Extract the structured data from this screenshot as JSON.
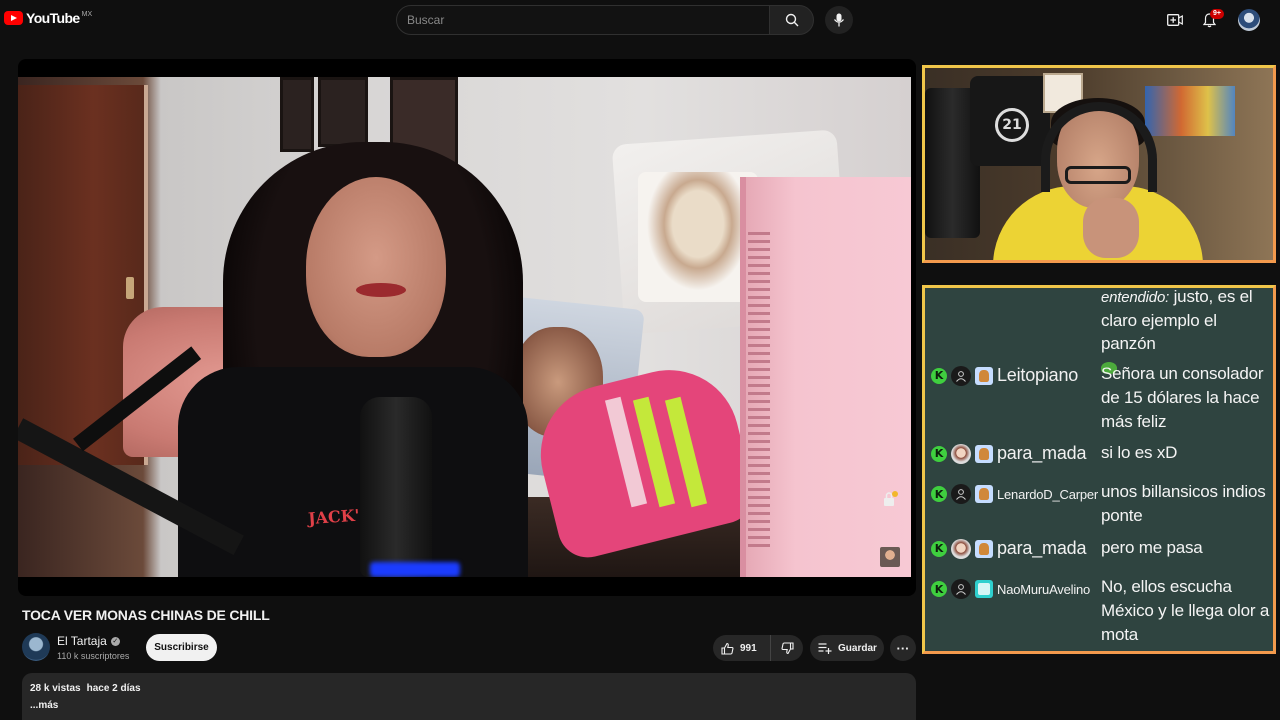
{
  "topbar": {
    "logo_text": "YouTube",
    "country_code": "MX",
    "search_placeholder": "Buscar",
    "notification_count": "9+",
    "icons": [
      "youtube-logo",
      "search-icon",
      "mic-icon",
      "create-icon",
      "bell-icon",
      "account-avatar"
    ]
  },
  "video": {
    "title": "TOCA VER MONAS CHINAS DE CHILL",
    "shirt_print": "JACK'S"
  },
  "webcam": {
    "poster_number": "21"
  },
  "chat": {
    "top_message": {
      "user_partial": "entendido:",
      "text": "justo, es el claro ejemplo el panzón"
    },
    "messages": [
      {
        "user": "Leitopiano",
        "text": "Señora un consolador de 15 dólares la hace más feliz"
      },
      {
        "user": "para_mada",
        "text": "si lo es xD"
      },
      {
        "user": "LenardoD_Carper",
        "text": "unos billansicos indios ponte"
      },
      {
        "user": "para_mada",
        "text": "pero me pasa"
      },
      {
        "user": "NaoMuruAvelino",
        "text": "No, ellos escucha México y le llega olor a mota"
      }
    ],
    "badge_letter": "K"
  },
  "channel": {
    "name": "El Tartaja",
    "subscribers": "110 k suscriptores",
    "subscribe_label": "Suscribirse"
  },
  "actions": {
    "like_count": "991",
    "save_label": "Guardar",
    "more_label": "···"
  },
  "description": {
    "views": "28 k vistas",
    "date": "hace 2 días",
    "more": "...más"
  },
  "colors": {
    "background": "#0f0f0f",
    "youtube_red": "#ff0000",
    "overlay_border": "#f0c64a",
    "chat_bg": "#2f4440",
    "kick_green": "#3fcf3f"
  }
}
